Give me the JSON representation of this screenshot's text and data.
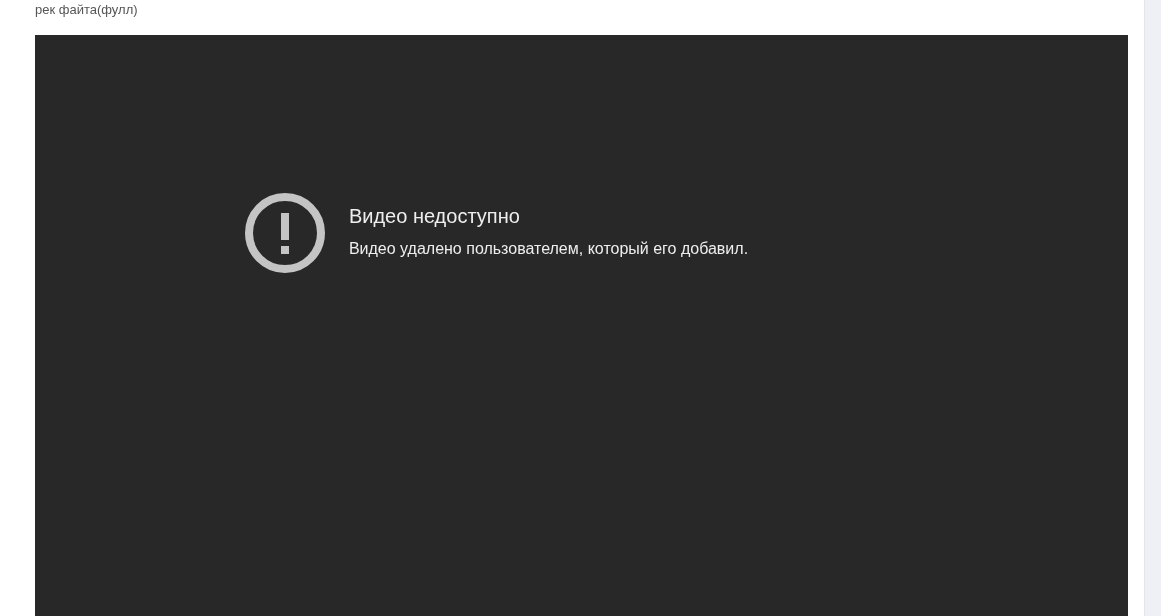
{
  "caption": "рек файта(фулл)",
  "player": {
    "error_title": "Видео недоступно",
    "error_message": "Видео удалено пользователем, который его добавил."
  }
}
